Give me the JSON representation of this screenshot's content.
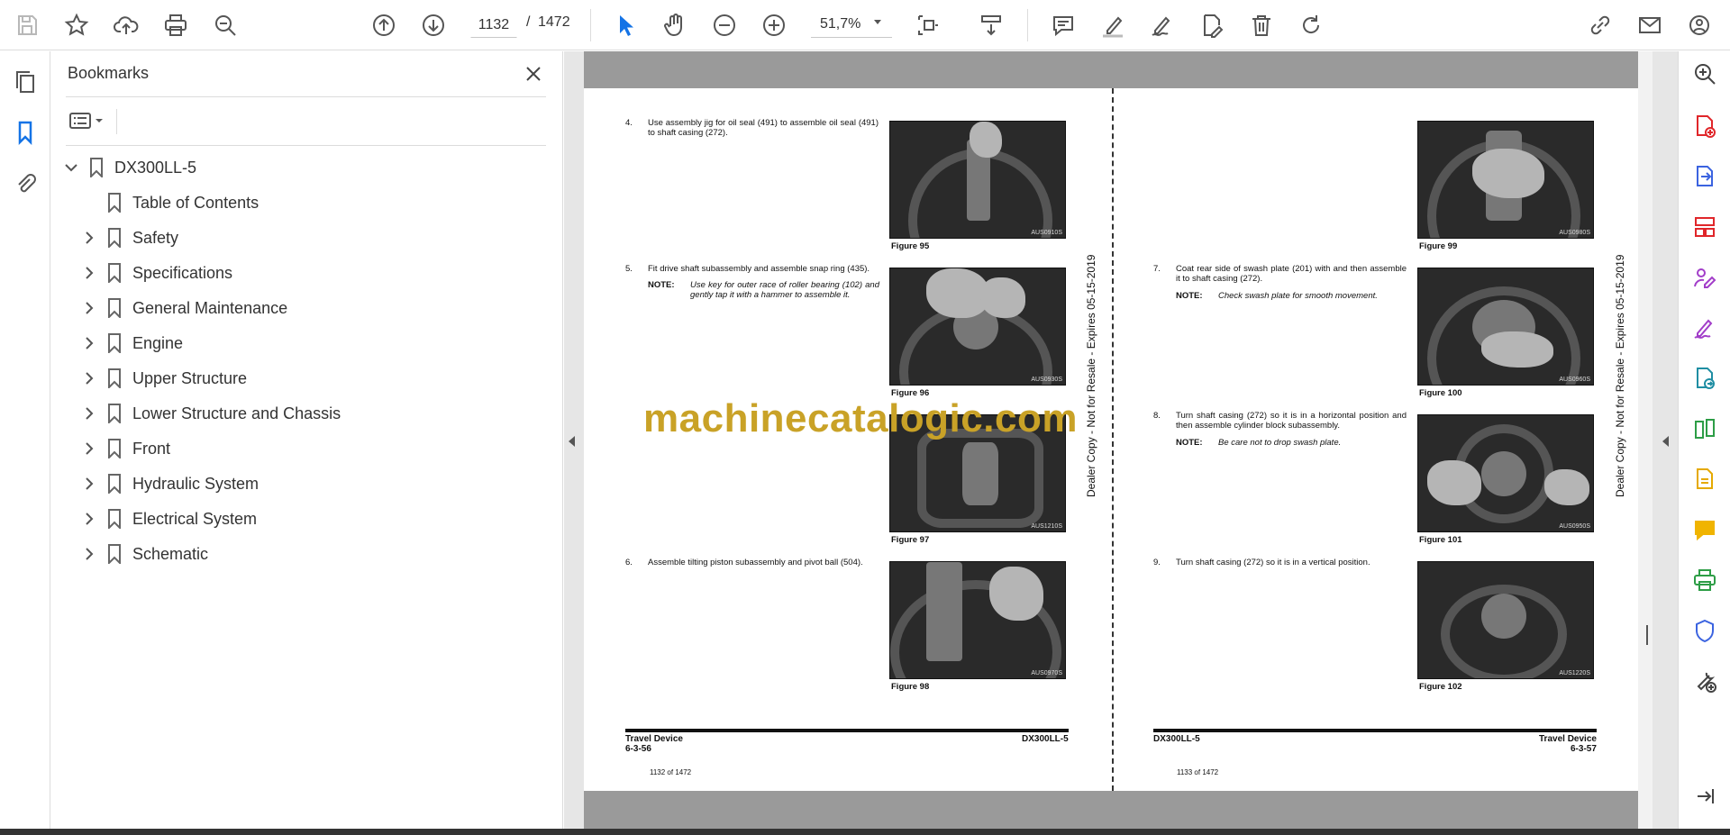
{
  "toolbar": {
    "page_current": "1132",
    "page_separator": "/",
    "page_total": "1472",
    "zoom": "51,7%",
    "icons": [
      "save-icon",
      "star-icon",
      "cloud-upload-icon",
      "print-icon",
      "search-zoom-icon",
      "page-up-icon",
      "page-down-icon",
      "select-arrow-icon",
      "hand-icon",
      "zoom-out-icon",
      "zoom-in-icon",
      "fit-page-icon",
      "scroll-mode-icon",
      "comment-icon",
      "highlight-icon",
      "sign-icon",
      "edit-icon",
      "delete-icon",
      "rotate-icon",
      "share-link-icon",
      "email-icon",
      "account-icon"
    ]
  },
  "left_rail": [
    "pages-icon",
    "bookmark-icon",
    "attachment-icon"
  ],
  "bookmarks": {
    "title": "Bookmarks",
    "root": "DX300LL-5",
    "items": [
      {
        "label": "Table of Contents",
        "expandable": false
      },
      {
        "label": "Safety",
        "expandable": true
      },
      {
        "label": "Specifications",
        "expandable": true
      },
      {
        "label": "General Maintenance",
        "expandable": true
      },
      {
        "label": "Engine",
        "expandable": true
      },
      {
        "label": "Upper Structure",
        "expandable": true
      },
      {
        "label": "Lower Structure and Chassis",
        "expandable": true
      },
      {
        "label": "Front",
        "expandable": true
      },
      {
        "label": "Hydraulic System",
        "expandable": true
      },
      {
        "label": "Electrical System",
        "expandable": true
      },
      {
        "label": "Schematic",
        "expandable": true
      }
    ]
  },
  "right_rail": [
    "zoom-search-icon",
    "create-pdf-icon",
    "export-pdf-icon",
    "organize-pages-icon",
    "fill-sign-icon",
    "request-sign-icon",
    "send-review-icon",
    "compare-icon",
    "scan-icon",
    "comment-panel-icon",
    "print-production-icon",
    "protect-icon",
    "more-tools-icon",
    "collapse-icon"
  ],
  "document": {
    "left_page": {
      "steps": [
        {
          "num": "4.",
          "text": "Use assembly jig for oil seal (491) to assemble oil seal (491) to shaft casing (272)."
        },
        {
          "num": "5.",
          "text": "Fit drive shaft subassembly and assemble snap ring (435).",
          "note_label": "NOTE:",
          "note": "Use key for outer race of roller bearing (102) and gently tap it with a hammer to assemble it."
        },
        {
          "num": "6.",
          "text": "Assemble tilting piston subassembly and pivot ball (504)."
        }
      ],
      "figures": [
        {
          "label": "Figure 95",
          "code": "AUS0910S"
        },
        {
          "label": "Figure 96",
          "code": "AUS0930S"
        },
        {
          "label": "Figure 97",
          "code": "AUS1210S"
        },
        {
          "label": "Figure 98",
          "code": "AUS0970S"
        }
      ],
      "side_text": "Dealer Copy - Not for Resale - Expires 05-15-2019",
      "footer_left_title": "Travel Device",
      "footer_left_num": "6-3-56",
      "footer_right": "DX300LL-5",
      "page_counter": "1132 of 1472"
    },
    "right_page": {
      "steps": [
        {
          "num": "7.",
          "text": "Coat rear side of swash plate (201) with and then assemble it to shaft casing (272).",
          "note_label": "NOTE:",
          "note": "Check swash plate for smooth movement."
        },
        {
          "num": "8.",
          "text": "Turn shaft casing (272) so it is in a horizontal position and then assemble cylinder block subassembly.",
          "note_label": "NOTE:",
          "note": "Be care not to drop swash plate."
        },
        {
          "num": "9.",
          "text": "Turn shaft casing (272) so it is in a vertical position."
        }
      ],
      "figures": [
        {
          "label": "Figure 99",
          "code": "AUS0980S"
        },
        {
          "label": "Figure 100",
          "code": "AUS0960S"
        },
        {
          "label": "Figure 101",
          "code": "AUS0950S"
        },
        {
          "label": "Figure 102",
          "code": "AUS1220S"
        }
      ],
      "side_text": "Dealer Copy - Not for Resale - Expires 05-15-2019",
      "footer_left": "DX300LL-5",
      "footer_right_title": "Travel Device",
      "footer_right_num": "6-3-57",
      "page_counter": "1133 of 1472"
    },
    "watermark": "machinecatalogic.com"
  }
}
